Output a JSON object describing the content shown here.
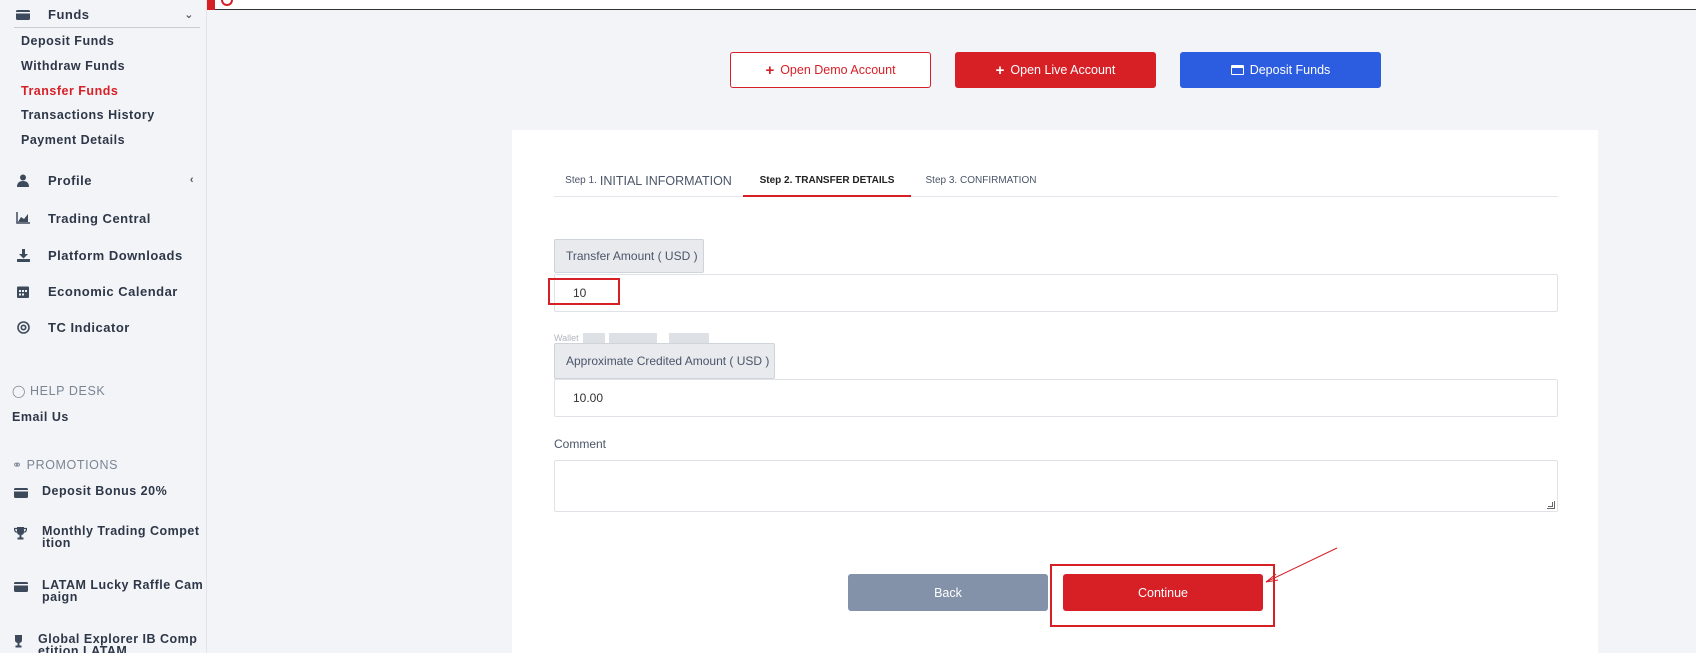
{
  "sidebar": {
    "funds": "Funds",
    "funds_sub": [
      "Deposit Funds",
      "Withdraw Funds",
      "Transfer Funds",
      "Transactions History",
      "Payment Details"
    ],
    "profile": "Profile",
    "trading_central": "Trading Central",
    "platform_downloads": "Platform Downloads",
    "economic_calendar": "Economic Calendar",
    "tc_indicator": "TC Indicator",
    "help_desk": "HELP DESK",
    "email_us": "Email Us",
    "promotions": "PROMOTIONS",
    "promos": [
      [
        "Deposit Bonus 20%"
      ],
      [
        "Monthly Trading Compet",
        "ition"
      ],
      [
        "LATAM Lucky Raffle Cam",
        "paign"
      ],
      [
        "Global Explorer IB Comp",
        "etition LATAM"
      ]
    ]
  },
  "top_buttons": {
    "demo": "Open Demo Account",
    "live": "Open Live Account",
    "deposit": "Deposit Funds"
  },
  "steps": {
    "step1_prefix": "Step 1.",
    "step1_name": "INITIAL INFORMATION",
    "step2": "Step 2. TRANSFER DETAILS",
    "step3": "Step 3. CONFIRMATION"
  },
  "form": {
    "amount_label": "Transfer Amount ( USD )",
    "amount_value": "10",
    "wallet_label": "Wallet",
    "credited_label": "Approximate Credited Amount ( USD )",
    "credited_value": "10.00",
    "comment_label": "Comment",
    "comment_value": ""
  },
  "actions": {
    "back": "Back",
    "continue": "Continue"
  },
  "colors": {
    "accent_red": "#d71f26",
    "blue": "#2c5ce0",
    "back_gray": "#8392a8"
  }
}
